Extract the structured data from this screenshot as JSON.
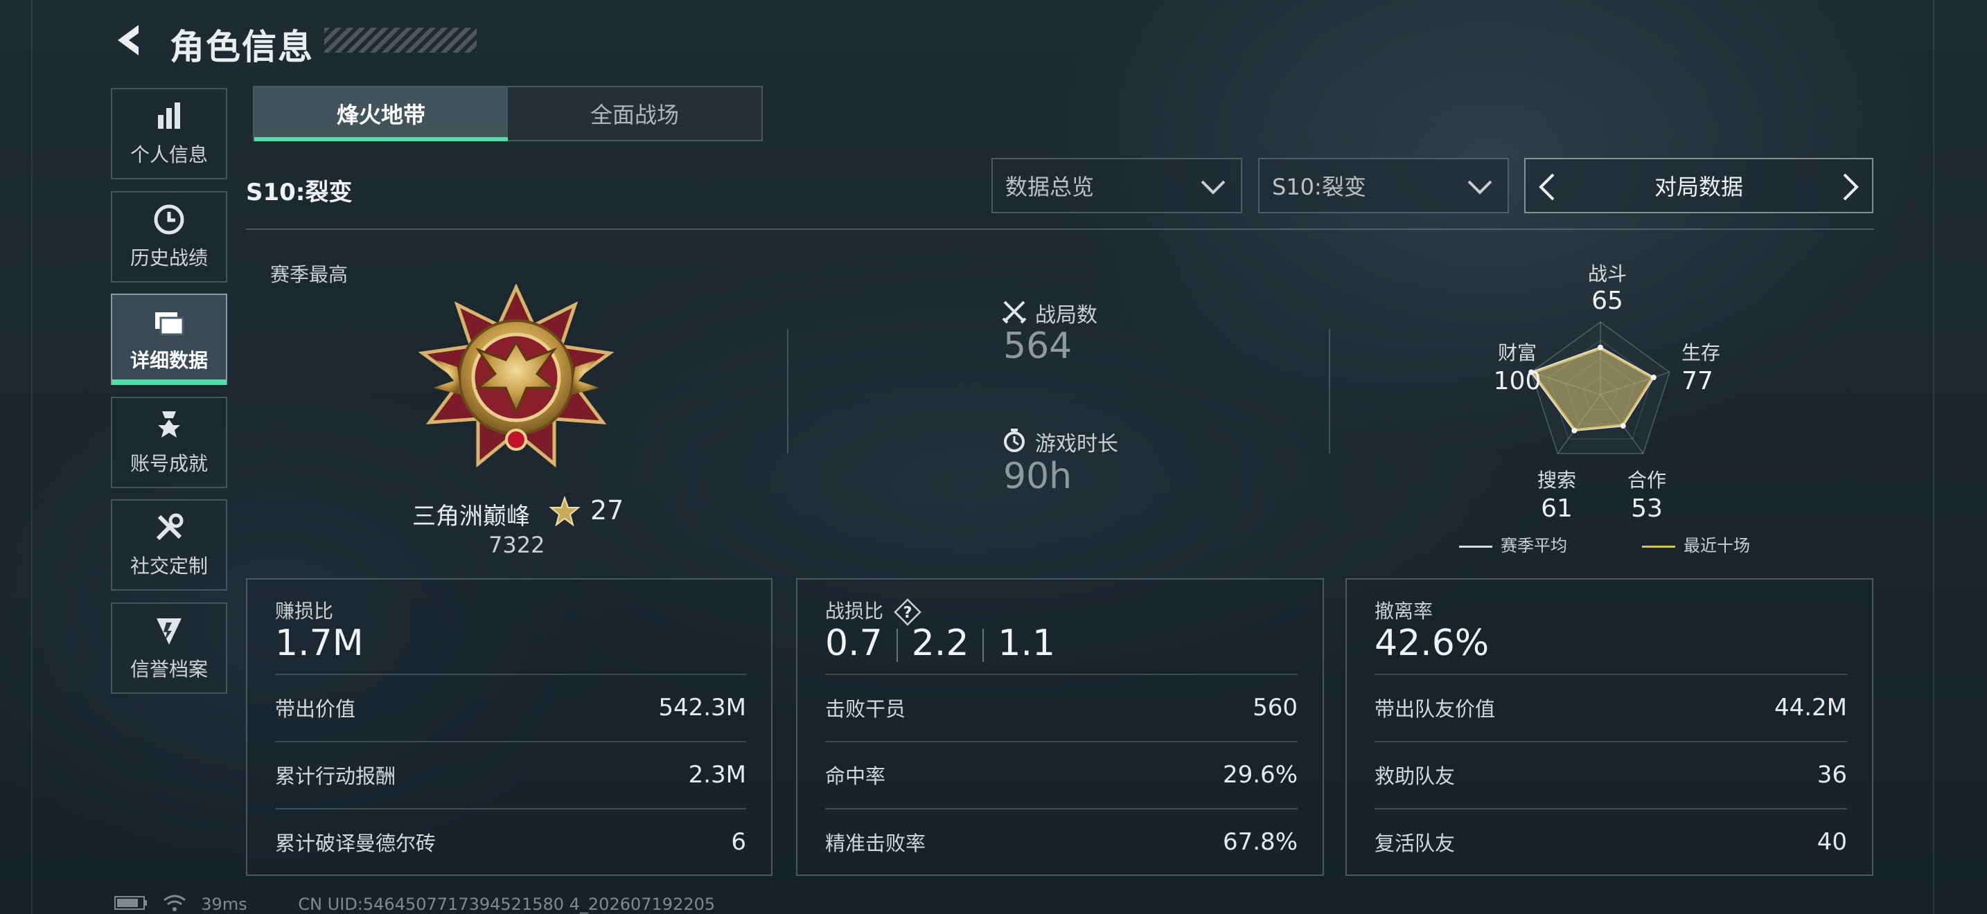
{
  "header": {
    "title": "角色信息"
  },
  "sidebar": {
    "items": [
      {
        "label": "个人信息",
        "icon": "bar-chart-icon"
      },
      {
        "label": "历史战绩",
        "icon": "clock-icon"
      },
      {
        "label": "详细数据",
        "icon": "folder-icon",
        "active": true
      },
      {
        "label": "账号成就",
        "icon": "medal-icon"
      },
      {
        "label": "社交定制",
        "icon": "tools-icon"
      },
      {
        "label": "信誉档案",
        "icon": "shield-badge-icon"
      }
    ]
  },
  "mode_tabs": [
    {
      "label": "烽火地带",
      "active": true
    },
    {
      "label": "全面战场",
      "active": false
    }
  ],
  "season_label": "S10:裂变",
  "filters": {
    "data_type": "数据总览",
    "season": "S10:裂变",
    "pager_label": "对局数据"
  },
  "rank": {
    "section_label": "赛季最高",
    "name": "三角洲巅峰",
    "stars": "27",
    "score": "7322"
  },
  "summary": {
    "matches_label": "战局数",
    "matches_value": "564",
    "playtime_label": "游戏时长",
    "playtime_value": "90h"
  },
  "radar": {
    "axes": [
      {
        "label": "战斗",
        "value": "65"
      },
      {
        "label": "生存",
        "value": "77"
      },
      {
        "label": "合作",
        "value": "53"
      },
      {
        "label": "搜索",
        "value": "61"
      },
      {
        "label": "财富",
        "value": "100"
      }
    ],
    "legend": [
      {
        "label": "赛季平均",
        "color": "#d8dde0"
      },
      {
        "label": "最近十场",
        "color": "#d9c15a"
      }
    ]
  },
  "cards": [
    {
      "title": "赚损比",
      "big": "1.7M",
      "rows": [
        {
          "k": "带出价值",
          "v": "542.3M"
        },
        {
          "k": "累计行动报酬",
          "v": "2.3M"
        },
        {
          "k": "累计破译曼德尔砖",
          "v": "6"
        }
      ]
    },
    {
      "title": "战损比",
      "big_parts": [
        "0.7",
        "2.2",
        "1.1"
      ],
      "rows": [
        {
          "k": "击败干员",
          "v": "560"
        },
        {
          "k": "命中率",
          "v": "29.6%"
        },
        {
          "k": "精准击败率",
          "v": "67.8%"
        }
      ]
    },
    {
      "title": "撤离率",
      "big": "42.6%",
      "rows": [
        {
          "k": "带出队友价值",
          "v": "44.2M"
        },
        {
          "k": "救助队友",
          "v": "36"
        },
        {
          "k": "复活队友",
          "v": "40"
        }
      ]
    }
  ],
  "footer": {
    "ping": "39ms",
    "uid": "CN UID:5464507717394521580 4_202607192205"
  }
}
